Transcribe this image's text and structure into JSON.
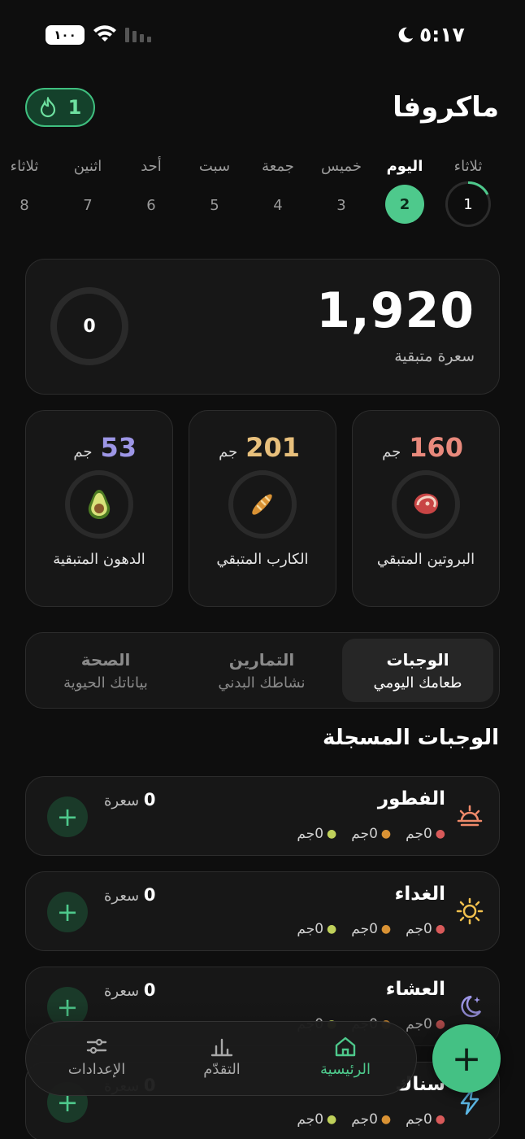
{
  "status": {
    "time": "٥:١٧",
    "battery": "١٠٠"
  },
  "header": {
    "title": "ماكروفا",
    "streak": "1"
  },
  "days": [
    {
      "name": "ثلاثاء",
      "num": "1"
    },
    {
      "name": "اليوم",
      "num": "2"
    },
    {
      "name": "خميس",
      "num": "3"
    },
    {
      "name": "جمعة",
      "num": "4"
    },
    {
      "name": "سبت",
      "num": "5"
    },
    {
      "name": "أحد",
      "num": "6"
    },
    {
      "name": "اثنين",
      "num": "7"
    },
    {
      "name": "ثلاثاء",
      "num": "8"
    }
  ],
  "calories": {
    "remaining": "1,920",
    "label": "سعرة متبقية",
    "eaten": "0"
  },
  "macros": [
    {
      "value": "160",
      "unit": "جم",
      "label": "البروتين المتبقي",
      "icon": "steak-icon",
      "color": "#e8897c"
    },
    {
      "value": "201",
      "unit": "جم",
      "label": "الكارب المتبقي",
      "icon": "bread-icon",
      "color": "#e8c07c"
    },
    {
      "value": "53",
      "unit": "جم",
      "label": "الدهون المتبقية",
      "icon": "avocado-icon",
      "color": "#9d96e6"
    }
  ],
  "tabs": [
    {
      "title": "الوجبات",
      "sub": "طعامك اليومي"
    },
    {
      "title": "التمارين",
      "sub": "نشاطك البدني"
    },
    {
      "title": "الصحة",
      "sub": "بياناتك الحيوية"
    }
  ],
  "meals_title": "الوجبات المسجلة",
  "kcal_unit": "سعرة",
  "macro_amount": "0جم",
  "meals": [
    {
      "name": "الفطور",
      "kcal": "0",
      "icon": "sunrise-icon"
    },
    {
      "name": "الغداء",
      "kcal": "0",
      "icon": "sun-icon"
    },
    {
      "name": "العشاء",
      "kcal": "0",
      "icon": "moon-star-icon"
    },
    {
      "name": "سناك",
      "kcal": "0",
      "icon": "lightning-icon"
    }
  ],
  "nav": [
    {
      "label": "الرئيسية",
      "icon": "home-icon"
    },
    {
      "label": "التقدّم",
      "icon": "chart-icon"
    },
    {
      "label": "الإعدادات",
      "icon": "sliders-icon"
    }
  ],
  "colors": {
    "accent": "#4ec98c",
    "protein": "#e8897c",
    "carb": "#e8c07c",
    "fat": "#9d96e6"
  }
}
